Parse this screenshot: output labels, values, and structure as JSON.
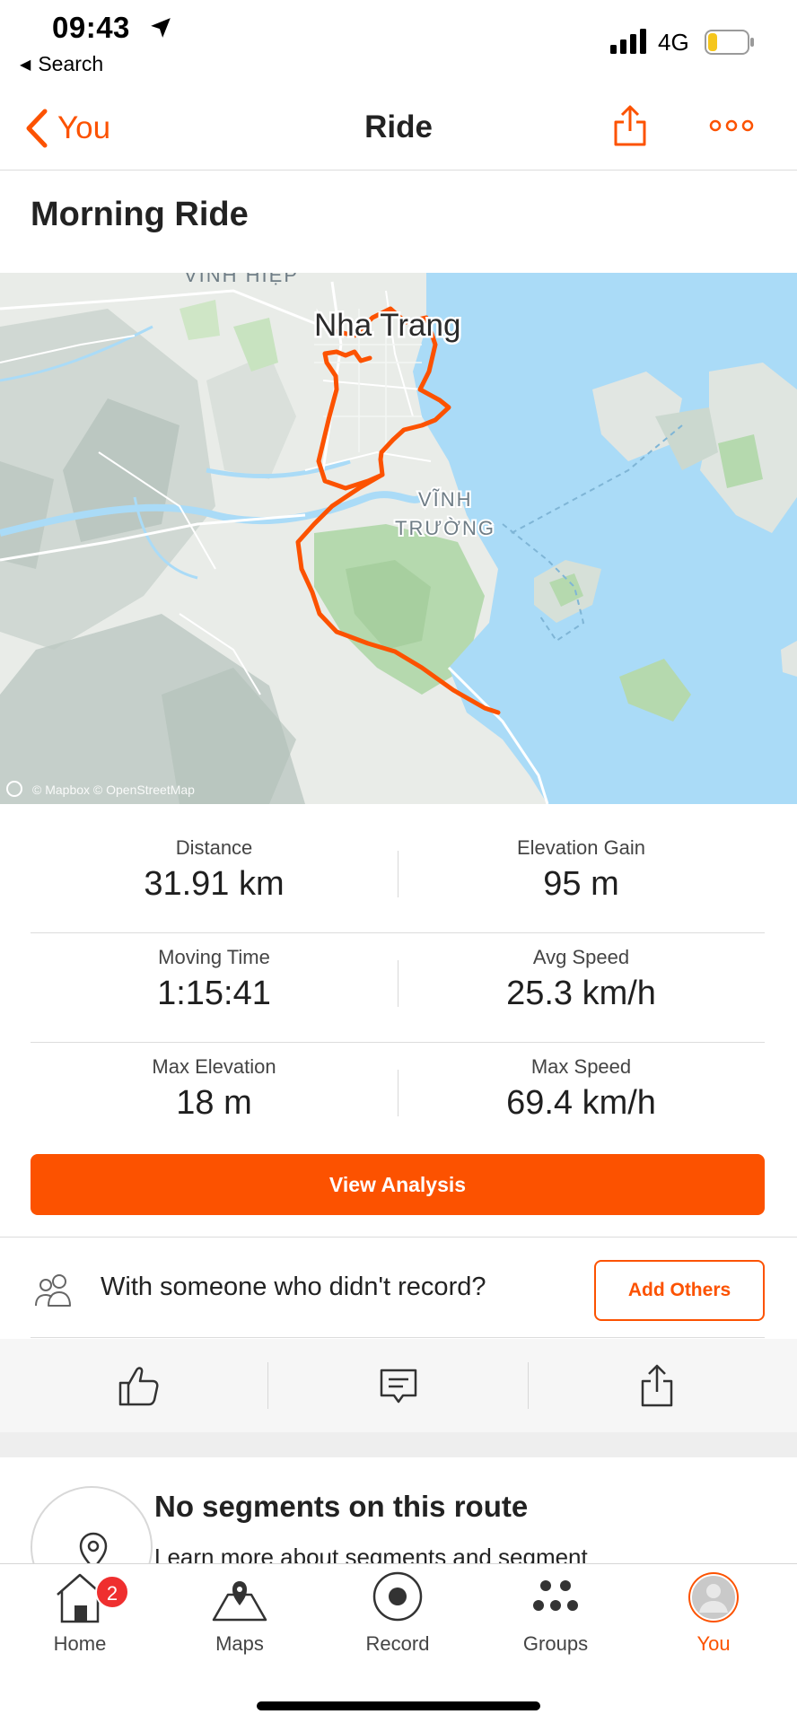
{
  "status": {
    "time": "09:43",
    "back_label": "Search",
    "network": "4G"
  },
  "nav": {
    "back_label": "You",
    "title": "Ride"
  },
  "activity": {
    "title": "Morning Ride"
  },
  "map": {
    "labels": {
      "district_top": "VĨNH HIỆP",
      "city": "Nha Trang",
      "district_1": "VĨNH",
      "district_2": "TRƯỜNG"
    },
    "attribution": "© Mapbox © OpenStreetMap",
    "route_color": "#fc5200",
    "water_color": "#aadbf7"
  },
  "stats": [
    {
      "left_label": "Distance",
      "left_value": "31.91 km",
      "right_label": "Elevation Gain",
      "right_value": "95 m"
    },
    {
      "left_label": "Moving Time",
      "left_value": "1:15:41",
      "right_label": "Avg Speed",
      "right_value": "25.3 km/h"
    },
    {
      "left_label": "Max Elevation",
      "left_value": "18 m",
      "right_label": "Max Speed",
      "right_value": "69.4 km/h"
    }
  ],
  "view_analysis_label": "View Analysis",
  "others": {
    "prompt": "With someone who didn't record?",
    "button_label": "Add Others"
  },
  "segments": {
    "title": "No segments on this route",
    "description": "Learn more about segments and segment"
  },
  "tabs": [
    {
      "label": "Home",
      "icon": "home-icon",
      "badge": "2"
    },
    {
      "label": "Maps",
      "icon": "map-icon"
    },
    {
      "label": "Record",
      "icon": "record-icon"
    },
    {
      "label": "Groups",
      "icon": "groups-icon"
    },
    {
      "label": "You",
      "icon": "profile-icon",
      "active": true
    }
  ],
  "colors": {
    "accent": "#fc5200",
    "badge": "#ef2f2f"
  }
}
